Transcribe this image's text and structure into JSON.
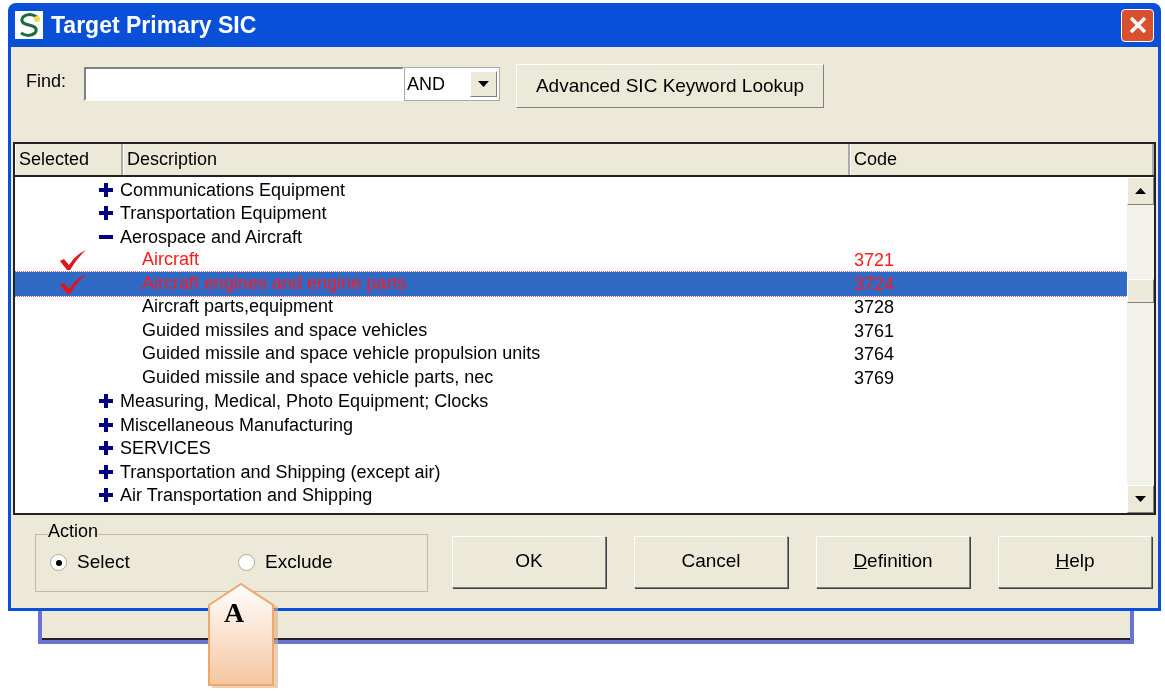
{
  "window": {
    "title": "Target Primary SIC"
  },
  "find": {
    "label": "Find:",
    "operator": "AND",
    "lookup_button": "Advanced SIC Keyword Lookup"
  },
  "table": {
    "columns": [
      "Selected",
      "Description",
      "Code"
    ],
    "rows": [
      {
        "description": "Communications Equipment",
        "expanded": false
      },
      {
        "description": "Transportation Equipment",
        "expanded": false
      },
      {
        "description": "Aerospace and Aircraft",
        "expanded": true,
        "children": [
          {
            "description": "Aircraft",
            "code": "3721",
            "checked": true,
            "selected": false
          },
          {
            "description": "Aircraft engines and engine parts",
            "code": "3724",
            "checked": true,
            "selected": true
          },
          {
            "description": "Aircraft parts,equipment",
            "code": "3728",
            "checked": false,
            "selected": false
          },
          {
            "description": "Guided missiles and space vehicles",
            "code": "3761",
            "checked": false,
            "selected": false
          },
          {
            "description": "Guided missile and space vehicle propulsion units",
            "code": "3764",
            "checked": false,
            "selected": false
          },
          {
            "description": "Guided missile and space vehicle parts, nec",
            "code": "3769",
            "checked": false,
            "selected": false
          }
        ]
      },
      {
        "description": "Measuring, Medical, Photo Equipment; Clocks",
        "expanded": false
      },
      {
        "description": "Miscellaneous Manufacturing",
        "expanded": false
      },
      {
        "description": "SERVICES",
        "expanded": false
      },
      {
        "description": "Transportation and Shipping (except air)",
        "expanded": false
      },
      {
        "description": "Air Transportation and Shipping",
        "expanded": false
      }
    ]
  },
  "action": {
    "label": "Action",
    "options": [
      {
        "label": "Select",
        "selected": true
      },
      {
        "label": "Exclude",
        "selected": false
      }
    ]
  },
  "buttons": [
    {
      "label": "OK",
      "underline_first": false
    },
    {
      "label": "Cancel",
      "underline_first": false
    },
    {
      "label": "Definition",
      "underline_first": true
    },
    {
      "label": "Help",
      "underline_first": true
    }
  ],
  "callout": {
    "label": "A"
  }
}
